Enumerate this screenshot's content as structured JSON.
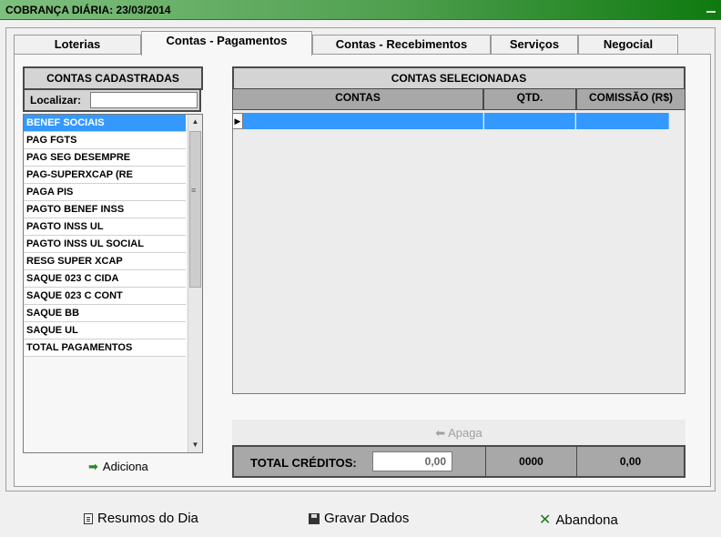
{
  "window": {
    "title": "COBRANÇA DIÁRIA: 23/03/2014"
  },
  "tabs": [
    {
      "label": "Loterias"
    },
    {
      "label": "Contas - Pagamentos"
    },
    {
      "label": "Contas - Recebimentos"
    },
    {
      "label": "Serviços"
    },
    {
      "label": "Negocial"
    }
  ],
  "left_panel": {
    "header": "CONTAS CADASTRADAS",
    "search_label": "Localizar:",
    "search_value": "",
    "items": [
      {
        "label": "BENEF SOCIAIS"
      },
      {
        "label": "PAG FGTS"
      },
      {
        "label": "PAG SEG  DESEMPRE"
      },
      {
        "label": "PAG-SUPERXCAP (RE"
      },
      {
        "label": "PAGA PIS"
      },
      {
        "label": "PAGTO BENEF INSS"
      },
      {
        "label": "PAGTO INSS  UL"
      },
      {
        "label": "PAGTO INSS  UL SOCIAL"
      },
      {
        "label": "RESG SUPER XCAP"
      },
      {
        "label": "SAQUE 023 C CIDA"
      },
      {
        "label": "SAQUE 023 C CONT"
      },
      {
        "label": "SAQUE BB"
      },
      {
        "label": "SAQUE UL"
      },
      {
        "label": "TOTAL PAGAMENTOS"
      }
    ],
    "add_label": "Adiciona"
  },
  "right_panel": {
    "header": "CONTAS SELECIONADAS",
    "columns": [
      "CONTAS",
      "QTD.",
      "COMISSÃO (R$)"
    ],
    "delete_label": "Apaga",
    "total_label": "TOTAL CRÉDITOS:",
    "total_value": "0,00",
    "total_qtd": "0000",
    "total_commission": "0,00"
  },
  "footer": {
    "summary_label": "Resumos do Dia",
    "save_label": "Gravar Dados",
    "cancel_label": "Abandona"
  },
  "colors": {
    "selection": "#3399ff",
    "header_gray": "#a8a8a8",
    "title_green": "#0f7a0f"
  }
}
